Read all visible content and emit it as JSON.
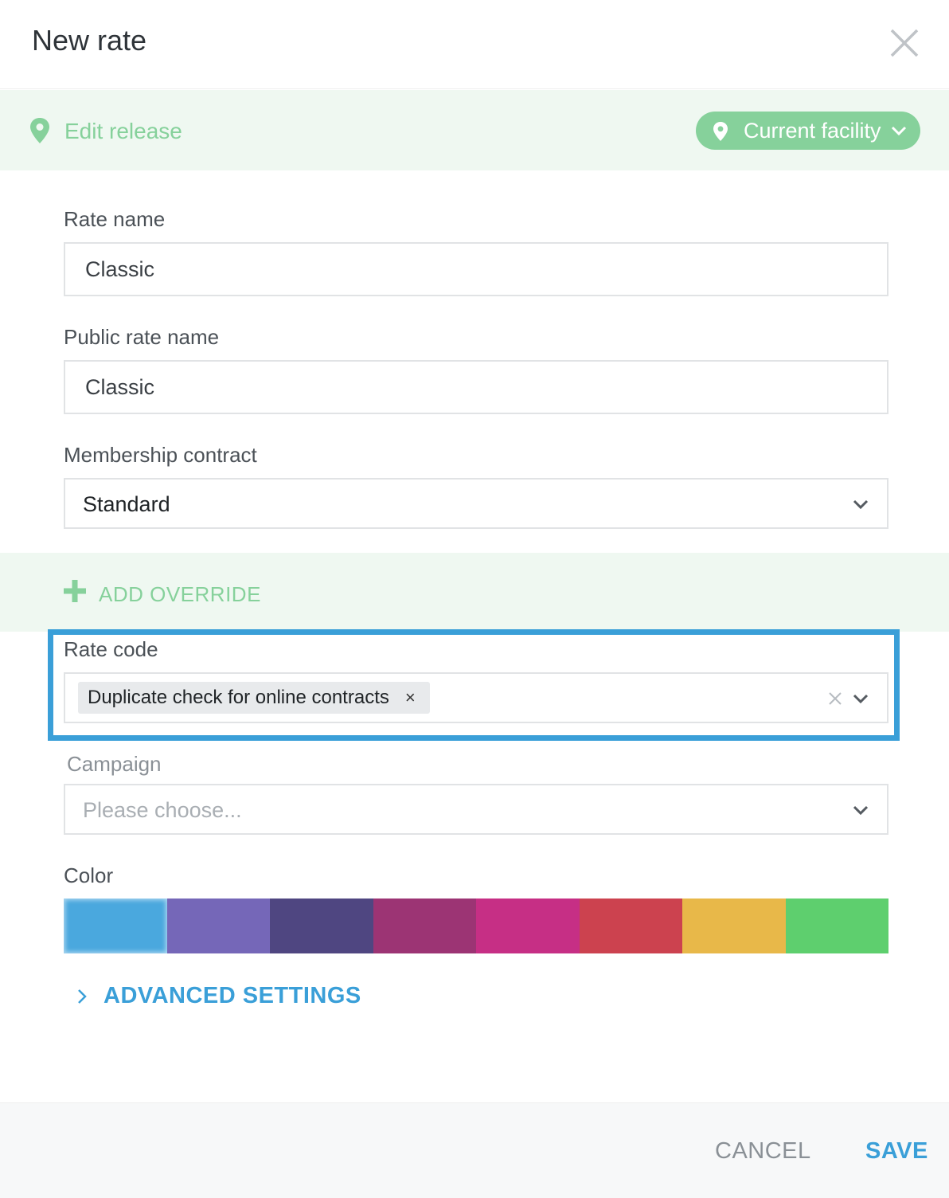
{
  "dialog": {
    "title": "New rate"
  },
  "release_bar": {
    "label": "Edit release",
    "facility_button": "Current facility"
  },
  "form": {
    "rate_name": {
      "label": "Rate name",
      "value": "Classic"
    },
    "public_rate_name": {
      "label": "Public rate name",
      "value": "Classic"
    },
    "membership_contract": {
      "label": "Membership contract",
      "value": "Standard"
    },
    "add_override": "ADD OVERRIDE",
    "rate_code": {
      "label": "Rate code",
      "selected": "Duplicate check for online contracts",
      "chip_remove": "×"
    },
    "campaign": {
      "label": "Campaign",
      "placeholder": "Please choose..."
    },
    "color": {
      "label": "Color",
      "swatches": [
        "#4aa8de",
        "#7567b8",
        "#4f4681",
        "#9c3474",
        "#c62f85",
        "#cc424f",
        "#e8b849",
        "#5ecf6e"
      ],
      "selected_index": 0
    },
    "advanced_settings": "ADVANCED SETTINGS"
  },
  "footer": {
    "cancel": "CANCEL",
    "save": "SAVE"
  },
  "colors": {
    "accent_green": "#86d19b",
    "accent_blue": "#3a9fd8",
    "tint_green": "#eff8f1"
  },
  "icons": {
    "close": "close-icon",
    "pin": "map-pin-icon",
    "chevron_down": "chevron-down-icon",
    "chevron_right": "chevron-right-icon",
    "plus": "plus-icon",
    "clear": "clear-icon"
  }
}
